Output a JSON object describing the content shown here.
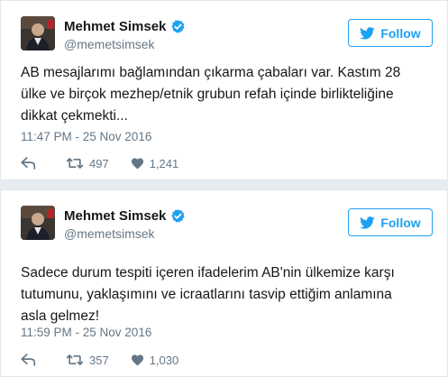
{
  "tweets": [
    {
      "display_name": "Mehmet Simsek",
      "handle": "@memetsimsek",
      "follow_label": "Follow",
      "text": "AB mesajlarımı bağlamından çıkarma çabaları var. Kastım 28\nülke ve birçok mezhep/etnik grubun refah içinde birlikteliğine\ndikkat çekmekti...",
      "timestamp": "11:47 PM - 25 Nov 2016",
      "retweets": "497",
      "likes": "1,241"
    },
    {
      "display_name": "Mehmet Simsek",
      "handle": "@memetsimsek",
      "follow_label": "Follow",
      "text": "Sadece durum tespiti içeren ifadelerim AB'nin ülkemize karşı\ntutumunu, yaklaşımını ve icraatlarını tasvip ettiğim anlamına\nasla gelmez!",
      "timestamp": "11:59 PM - 25 Nov 2016",
      "retweets": "357",
      "likes": "1,030"
    }
  ],
  "colors": {
    "accent": "#1da1f2",
    "text": "#14171a",
    "muted": "#657786",
    "background": "#e6ecf0"
  },
  "icons": [
    "twitter-bird-icon",
    "verified-badge-icon",
    "reply-icon",
    "retweet-icon",
    "heart-icon"
  ]
}
